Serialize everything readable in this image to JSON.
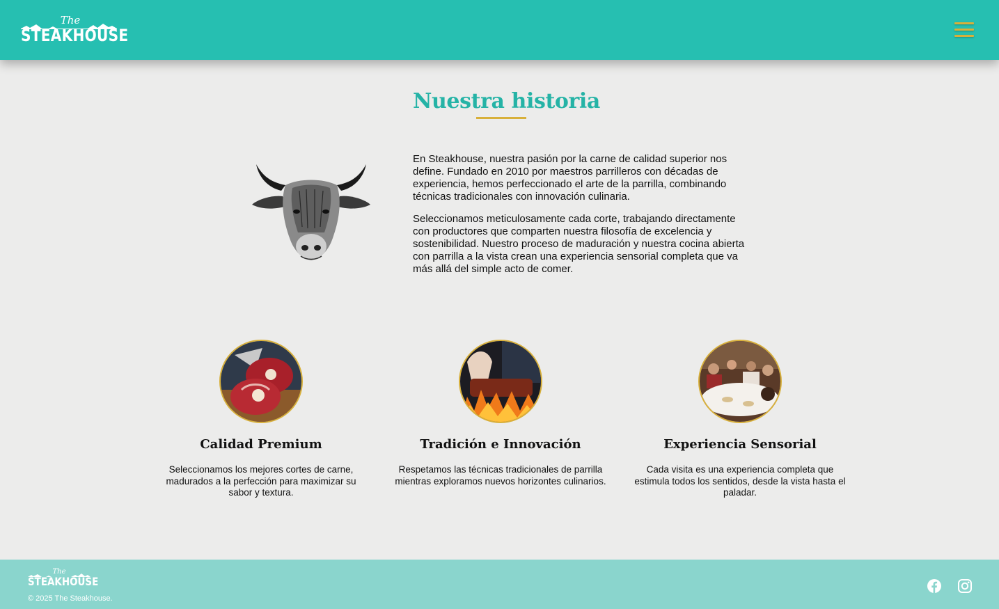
{
  "header": {
    "logo": {
      "small": "The",
      "word": "STEAKHOUSE"
    },
    "menu_icon": "hamburger-menu-icon"
  },
  "story": {
    "title": "Nuestra historia",
    "image_icon": "bull-head-illustration",
    "paragraphs": [
      "En Steakhouse, nuestra pasión por la carne de calidad superior nos define. Fundado en 2010 por maestros parrilleros con décadas de experiencia, hemos perfeccionado el arte de la parrilla, combinando técnicas tradicionales con innovación culinaria.",
      "Seleccionamos meticulosamente cada corte, trabajando directamente con productores que comparten nuestra filosofía de excelencia y sostenibilidad. Nuestro proceso de maduración y nuestra cocina abierta con parrilla a la vista crean una experiencia sensorial completa que va más allá del simple acto de comer."
    ]
  },
  "features": [
    {
      "title": "Calidad Premium",
      "text": "Seleccionamos los mejores cortes de carne, madurados a la perfección para maximizar su sabor y textura.",
      "image": "raw-meat-photo"
    },
    {
      "title": "Tradición e Innovación",
      "text": "Respetamos las técnicas tradicionales de parrilla mientras exploramos nuevos horizontes culinarios.",
      "image": "grill-fire-photo"
    },
    {
      "title": "Experiencia Sensorial",
      "text": "Cada visita es una experiencia completa que estimula todos los sentidos, desde la vista hasta el paladar.",
      "image": "dining-room-photo"
    }
  ],
  "footer": {
    "logo": {
      "small": "The",
      "word": "STEAKHOUSE"
    },
    "copyright": "© 2025 The Steakhouse.",
    "social": [
      "facebook-icon",
      "instagram-icon"
    ]
  },
  "colors": {
    "primary": "#26bfb1",
    "accent": "#d8b03a",
    "footer_bg": "#8ad5cd",
    "page_bg": "#ececeb",
    "title": "#25b3a6"
  }
}
